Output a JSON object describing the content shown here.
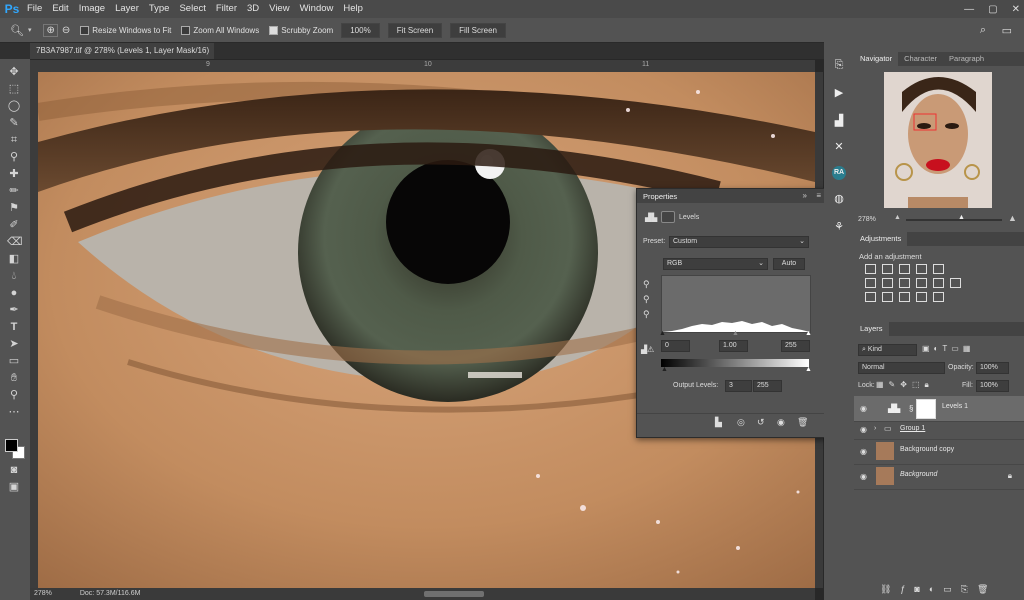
{
  "menubar": {
    "logo": "Ps",
    "items": [
      "File",
      "Edit",
      "Image",
      "Layer",
      "Type",
      "Select",
      "Filter",
      "3D",
      "View",
      "Window",
      "Help"
    ],
    "win_min": "—",
    "win_max": "▢",
    "win_close": "✕"
  },
  "options": {
    "resize_windows": "Resize Windows to Fit",
    "zoom_all": "Zoom All Windows",
    "scrubby": "Scrubby Zoom",
    "zoom_value": "100%",
    "fit_screen": "Fit Screen",
    "fill_screen": "Fill Screen"
  },
  "document": {
    "tab_title": "7B3A7987.tif @ 278% (Levels 1, Layer Mask/16) *",
    "tab_close": "×",
    "ruler_marks": [
      "9",
      "10",
      "11"
    ],
    "status_zoom": "278%",
    "status_doc": "Doc: 57.3M/116.6M"
  },
  "properties": {
    "tab": "Properties",
    "adjustment": "Levels",
    "preset_label": "Preset:",
    "preset_value": "Custom",
    "channel": "RGB",
    "auto": "Auto",
    "input_black": "0",
    "input_mid": "1.00",
    "input_white": "255",
    "output_label": "Output Levels:",
    "output_black": "3",
    "output_white": "255"
  },
  "navigator": {
    "tabs": [
      "Navigator",
      "Character",
      "Paragraph"
    ],
    "zoom": "278%"
  },
  "adjustments": {
    "tab": "Adjustments",
    "add_label": "Add an adjustment"
  },
  "layers": {
    "tab": "Layers",
    "kind": "Kind",
    "blend": "Normal",
    "opacity_label": "Opacity:",
    "opacity": "100%",
    "lock_label": "Lock:",
    "fill_label": "Fill:",
    "fill": "100%",
    "rows": [
      {
        "name": "Levels 1"
      },
      {
        "name": "Group 1"
      },
      {
        "name": "Background copy"
      },
      {
        "name": "Background"
      }
    ]
  },
  "colors": {
    "accent": "#31a8ff",
    "panel": "#535353",
    "canvas_bg": "#282828"
  }
}
